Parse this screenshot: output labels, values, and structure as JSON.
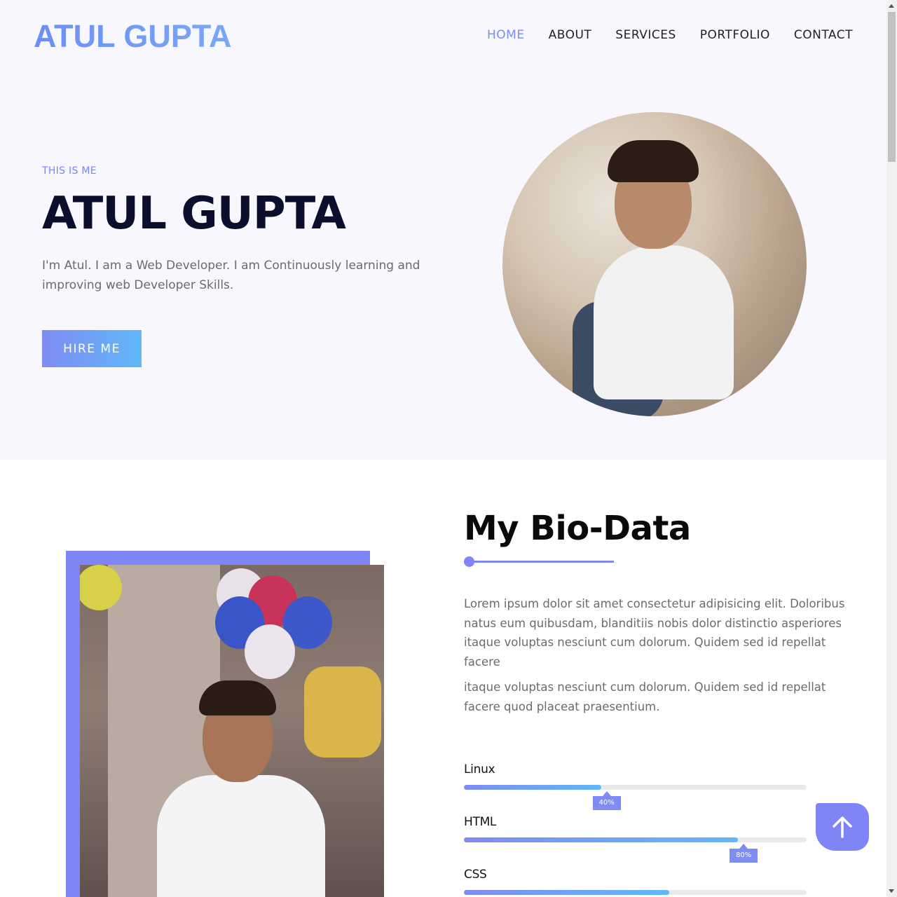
{
  "header": {
    "logo": "ATUL GUPTA",
    "nav": [
      {
        "label": "HOME",
        "active": true
      },
      {
        "label": "ABOUT",
        "active": false
      },
      {
        "label": "SERVICES",
        "active": false
      },
      {
        "label": "PORTFOLIO",
        "active": false
      },
      {
        "label": "CONTACT",
        "active": false
      }
    ]
  },
  "hero": {
    "eyebrow": "THIS IS ME",
    "title": "ATUL GUPTA",
    "description": "I'm Atul. I am a Web Developer. I am Continuously learning and improving web Developer Skills.",
    "cta_label": "HIRE ME"
  },
  "about": {
    "title": "My Bio-Data",
    "paragraph_1": "Lorem ipsum dolor sit amet consectetur adipisicing elit. Doloribus natus eum quibusdam, blanditiis nobis dolor distinctio asperiores itaque voluptas nesciunt cum dolorum. Quidem sed id repellat facere",
    "paragraph_2": "itaque voluptas nesciunt cum dolorum. Quidem sed id repellat facere quod placeat praesentium.",
    "skills": [
      {
        "name": "Linux",
        "percent": 40,
        "label": "40%"
      },
      {
        "name": "HTML",
        "percent": 80,
        "label": "80%"
      },
      {
        "name": "CSS",
        "percent": 60,
        "label": ""
      }
    ]
  },
  "colors": {
    "accent": "#7f85f6",
    "gradient_start": "#7f8cf3",
    "gradient_end": "#5fb8f8",
    "hero_bg": "#f8f7fe",
    "title_dark": "#0b0e2c"
  },
  "icons": {
    "scroll_top": "arrow-up-icon"
  }
}
